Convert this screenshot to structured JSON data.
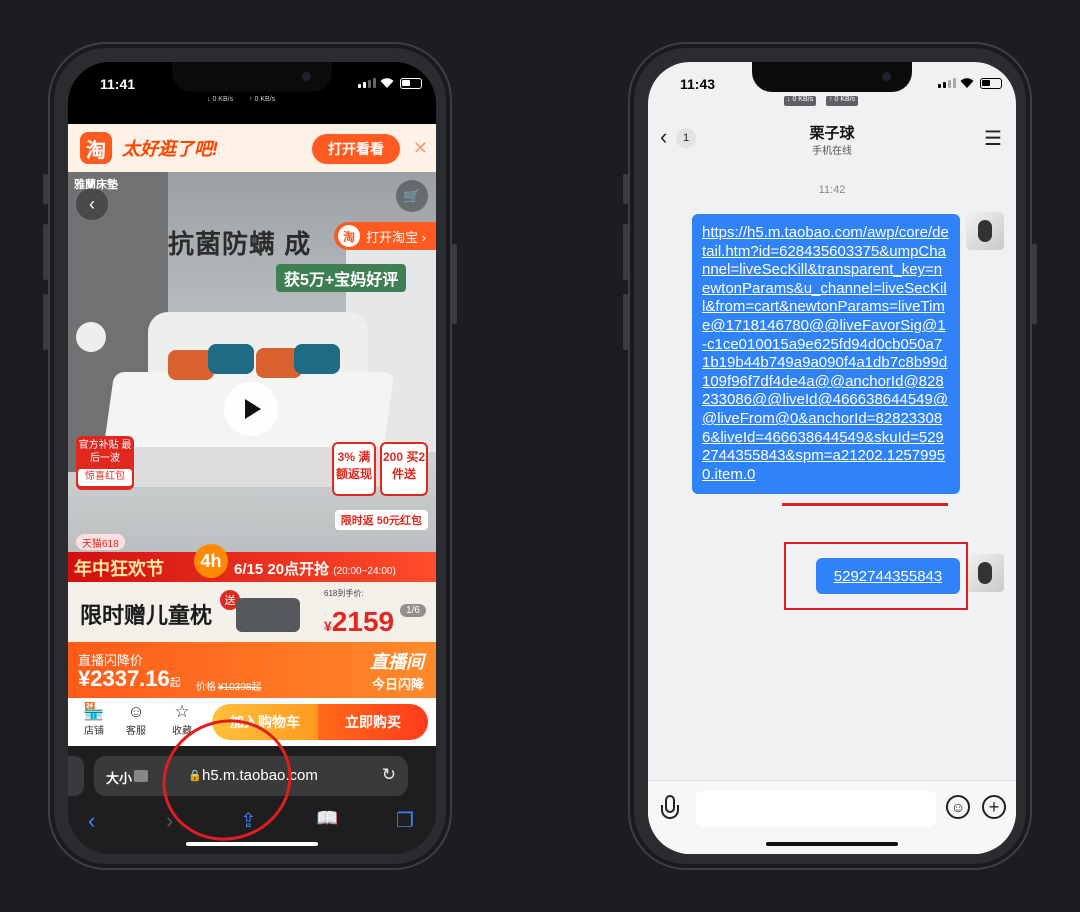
{
  "left_phone": {
    "status": {
      "time": "11:41",
      "net_down": "↓ 0 KB/s",
      "net_up": "↑ 0 KB/s"
    },
    "app_banner": {
      "logo": "淘",
      "slogan": "太好逛了吧!",
      "open_button": "打开看看",
      "close_icon": "✕"
    },
    "product_image": {
      "brand": "雅蘭床墊",
      "headline": "抗菌防螨 成",
      "subhead": "获5万+宝妈好评",
      "open_taobao": "打开淘宝 ›",
      "open_taobao_logo": "淘",
      "back_icon": "‹",
      "cart_icon": "🛒",
      "official_badge": "官方补贴 最后一波",
      "red_packet": "惊喜红包",
      "coupon1": "3% 满额返现",
      "coupon2": "200 买2件送",
      "rebate": "限时返 50元红包",
      "tmall_tag": "天猫618",
      "festival": "年中狂欢节",
      "festival_badge": "4h",
      "festival_time": "6/15 20点开抢",
      "festival_time_sub": "(20:00~24:00)",
      "gift_title": "限时赠儿童枕",
      "gift_tag": "送",
      "gift_price_label": "618到手价:",
      "gift_price": "2159",
      "gift_currency": "¥",
      "image_index": "1/6"
    },
    "flash_sale": {
      "label": "直播闪降价",
      "price": "¥2337.16",
      "price_suffix": "起",
      "orig_label": "价格",
      "orig_price": "¥10398起",
      "live": "直播间",
      "today": "今日闪降"
    },
    "action_bar": {
      "store": "店铺",
      "store_icon": "🏪",
      "service": "客服",
      "service_icon": "☺",
      "favorite": "收藏",
      "favorite_icon": "☆",
      "add_cart": "加入购物车",
      "buy_now": "立即购买"
    },
    "safari": {
      "aa": "大小",
      "lock": "🔒",
      "url": "h5.m.taobao.com",
      "reload": "↻",
      "tools": {
        "back": "‹",
        "forward": "›",
        "share": "⇪",
        "bookmarks": "📖",
        "tabs": "❐"
      }
    }
  },
  "right_phone": {
    "status": {
      "time": "11:43",
      "net_down": "↓ 0 KB/s",
      "net_up": "↑ 0 KB/s"
    },
    "header": {
      "back": "‹",
      "unread": "1",
      "name": "栗子球",
      "status": "手机在线",
      "menu": "☰"
    },
    "messages": {
      "time": "11:42",
      "link": "https://h5.m.taobao.com/awp/core/detail.htm?id=628435603375&umpChannel=liveSecKill&transparent_key=newtonParams&u_channel=liveSecKill&from=cart&newtonParams=liveTime@1718146780@@liveFavorSig@1-c1ce010015a9e625fd94d0cb050a71b19b44b749a9a090f4a1db7c8b99d109f96f7df4de4a@@anchorId@828233086@@liveId@466638644549@@liveFrom@0&anchorId=828233086&liveId=466638644549&skuId=5292744355843&spm=a21202.12579950.item.0",
      "sku": "5292744355843"
    },
    "input": {
      "mic_icon": "mic",
      "emoji_icon": "☺",
      "plus_icon": "+"
    }
  },
  "colors": {
    "taobao_orange": "#ff5a1f",
    "bubble_blue": "#2f83f7",
    "annotation_red": "#e01e1e"
  }
}
